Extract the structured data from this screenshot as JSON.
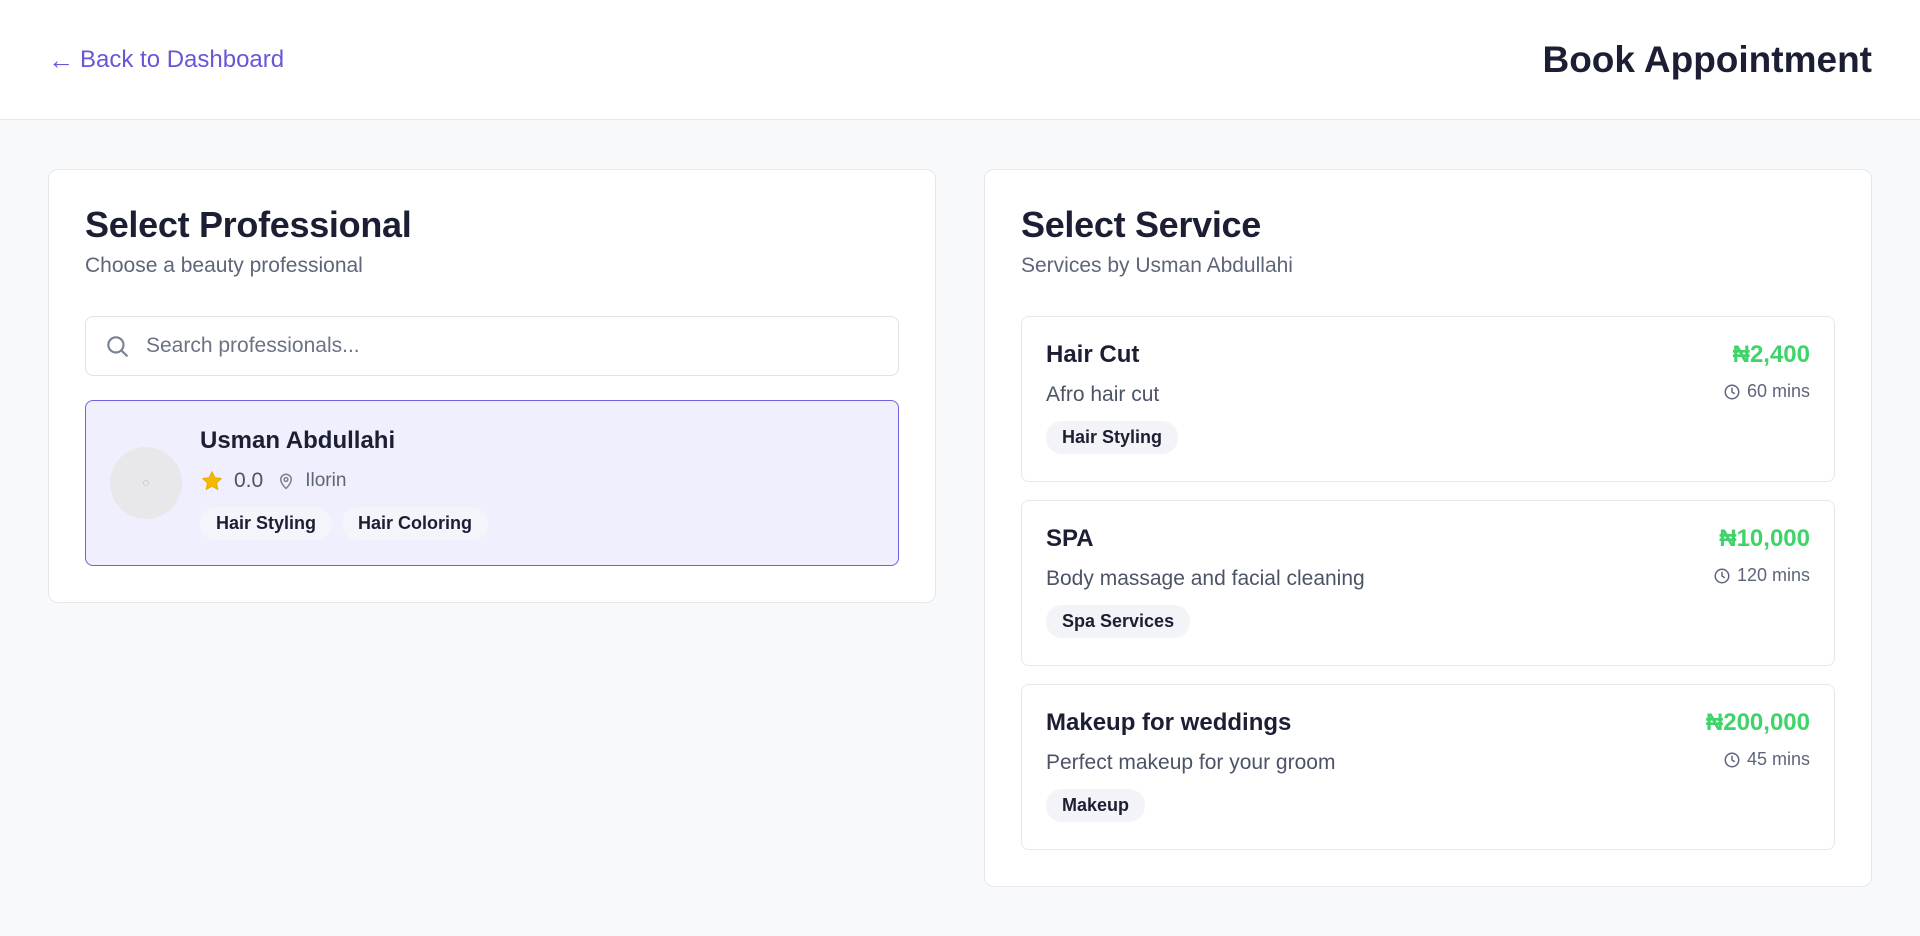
{
  "header": {
    "back_arrow": "←",
    "back_label": "Back to Dashboard",
    "title": "Book Appointment"
  },
  "professional_panel": {
    "title": "Select Professional",
    "subtitle": "Choose a beauty professional",
    "search": {
      "placeholder": "Search professionals...",
      "value": "",
      "icon": "search-icon"
    },
    "professionals": [
      {
        "name": "Usman Abdullahi",
        "rating": "0.0",
        "location": "Ilorin",
        "selected": true,
        "tags": [
          "Hair Styling",
          "Hair Coloring"
        ]
      }
    ]
  },
  "service_panel": {
    "title": "Select Service",
    "subtitle": "Services by Usman Abdullahi",
    "services": [
      {
        "name": "Hair Cut",
        "description": "Afro hair cut",
        "price": "₦2,400",
        "duration": "60 mins",
        "tag": "Hair Styling"
      },
      {
        "name": "SPA",
        "description": "Body massage and facial cleaning",
        "price": "₦10,000",
        "duration": "120 mins",
        "tag": "Spa Services"
      },
      {
        "name": "Makeup for weddings",
        "description": "Perfect makeup for your groom",
        "price": "₦200,000",
        "duration": "45 mins",
        "tag": "Makeup"
      }
    ]
  },
  "colors": {
    "accent": "#6657d9",
    "price": "#3fd36a",
    "star": "#f5b800",
    "selected_bg": "#efeffe"
  }
}
